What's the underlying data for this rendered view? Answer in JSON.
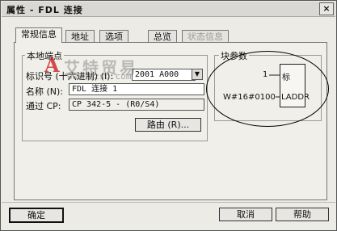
{
  "window": {
    "title": "属性 - FDL 连接",
    "close_label": "×"
  },
  "tabs": [
    {
      "label": "常规信息",
      "state": "active"
    },
    {
      "label": "地址",
      "state": "normal"
    },
    {
      "label": "选项",
      "state": "normal"
    },
    {
      "label": "总览",
      "state": "normal"
    },
    {
      "label": "状态信息",
      "state": "disabled"
    }
  ],
  "local_endpoint": {
    "group_label": "本地端点",
    "id_label": "标识号 (十六进制) (I):",
    "id_value": "2001 A000",
    "name_label": "名称 (N):",
    "name_value": "FDL 连接 1",
    "via_label": "通过 CP:",
    "via_value": "CP 342-5 - (R0/S4)",
    "route_button": "路由 (R)..."
  },
  "block_params": {
    "group_label": "块参数",
    "id_pin_value": "1",
    "id_pin_label": "标",
    "laddr_value": "W#16#0100",
    "laddr_label": "LADDR"
  },
  "watermark": {
    "logo": "A",
    "text": "艾特贸易",
    "url": "www.dzsc.com"
  },
  "footer": {
    "ok_label": "确定",
    "cancel_label": "取消",
    "help_label": "帮助"
  }
}
